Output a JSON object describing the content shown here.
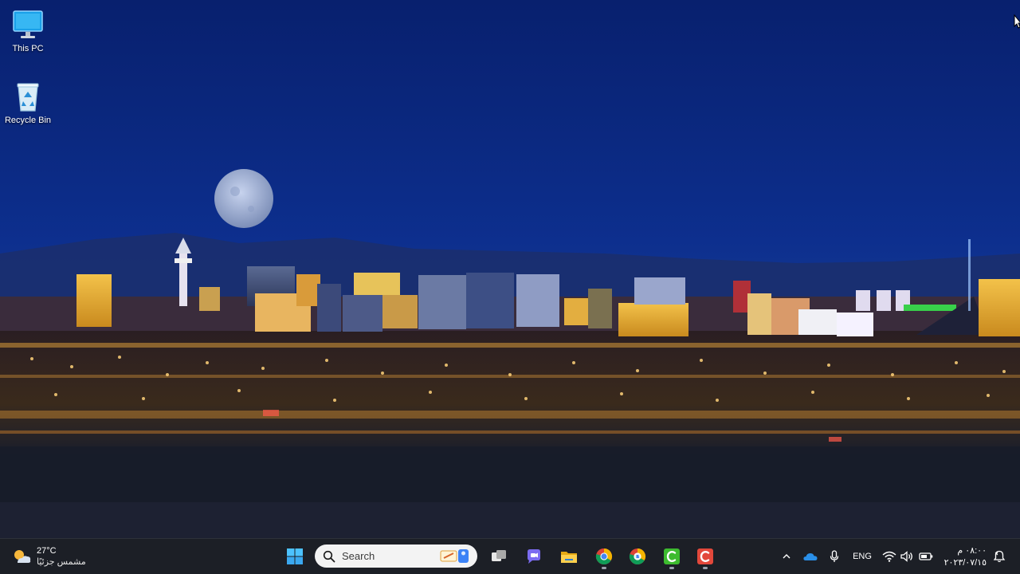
{
  "desktop": {
    "icons": [
      {
        "label": "This PC",
        "icon": "monitor-icon"
      },
      {
        "label": "Recycle Bin",
        "icon": "recycle-bin-icon"
      }
    ],
    "wallpaper": "city-night-skyline-with-moon"
  },
  "taskbar": {
    "weather": {
      "temperature": "27°C",
      "description": "مشمس جزئيًا",
      "icon": "partly-sunny-icon"
    },
    "start_icon": "windows-start-icon",
    "search": {
      "placeholder": "Search",
      "highlight_icon": "search-highlight-icon"
    },
    "pinned_apps": [
      {
        "name": "Task View",
        "icon": "task-view-icon"
      },
      {
        "name": "Chat",
        "icon": "chat-icon"
      },
      {
        "name": "File Explorer",
        "icon": "file-explorer-icon"
      },
      {
        "name": "Google Chrome",
        "icon": "chrome-icon"
      },
      {
        "name": "Chrome Beta",
        "icon": "chrome-beta-icon"
      },
      {
        "name": "Camtasia Recorder",
        "icon": "camtasia-recorder-icon"
      },
      {
        "name": "Camtasia",
        "icon": "camtasia-icon"
      }
    ],
    "tray": {
      "chevron_icon": "chevron-up-icon",
      "onedrive_icon": "onedrive-icon",
      "mic_icon": "microphone-icon",
      "language": "ENG",
      "wifi_icon": "wifi-icon",
      "volume_icon": "volume-icon",
      "battery_icon": "battery-icon",
      "time": "٠٨:٠٠ م",
      "date": "٢٠٢٣/٠٧/١٥",
      "notification_icon": "notification-bell-icon"
    }
  },
  "colors": {
    "sky_top": "#0c2a7c",
    "sky_bottom": "#1a3f9e",
    "taskbar_bg": "#1c1f26",
    "accent_blue": "#0078d4"
  }
}
